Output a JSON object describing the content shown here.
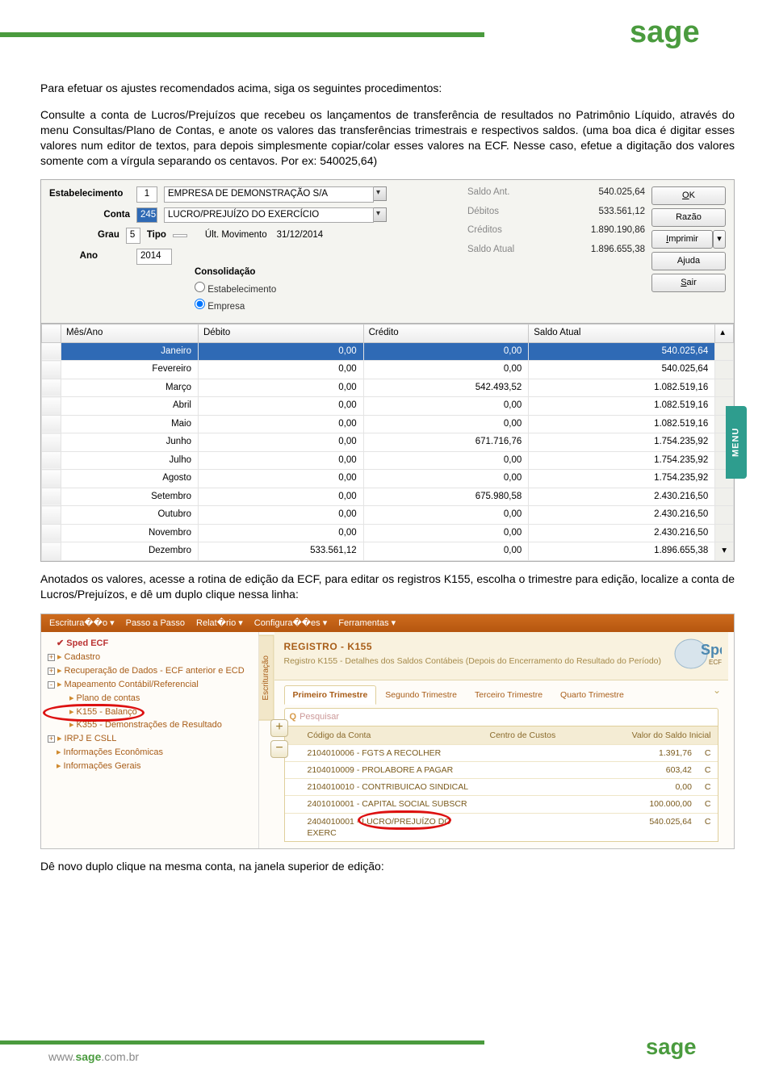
{
  "brand": "sage",
  "header_bar_color": "#4a9b3e",
  "paragraphs": {
    "p1": "Para efetuar os ajustes recomendados acima, siga os seguintes procedimentos:",
    "p2": "Consulte a conta de Lucros/Prejuízos que recebeu os lançamentos de transferência de resultados no Patrimônio Líquido, através do menu Consultas/Plano de Contas, e anote os valores das transferências trimestrais e respectivos saldos. (uma boa dica é digitar esses valores num editor de textos, para depois simplesmente copiar/colar esses valores na ECF. Nesse caso, efetue a digitação dos valores somente com a vírgula separando os centavos. Por ex: 540025,64)",
    "p3": "Anotados os valores, acesse a rotina de edição da ECF, para editar os registros K155, escolha o trimestre para edição, localize a conta de Lucros/Prejuízos, e dê um duplo clique nessa linha:",
    "p4": "Dê novo duplo clique na mesma conta, na janela superior de edição:"
  },
  "shot1": {
    "labels": {
      "estabelecimento": "Estabelecimento",
      "conta": "Conta",
      "grau": "Grau",
      "tipo": "Tipo",
      "ult_mov": "Últ. Movimento",
      "ano": "Ano",
      "consolidacao": "Consolidação",
      "opt_estab": "Estabelecimento",
      "opt_empresa": "Empresa"
    },
    "fields": {
      "estab_num": "1",
      "estab_nome": "EMPRESA DE DEMONSTRAÇÃO S/A",
      "conta_num": "245",
      "conta_nome": "LUCRO/PREJUÍZO DO EXERCÍCIO",
      "grau": "5",
      "tipo": "",
      "ult_mov": "31/12/2014",
      "ano": "2014"
    },
    "summary": {
      "saldo_ant_lbl": "Saldo Ant.",
      "saldo_ant": "540.025,64",
      "debitos_lbl": "Débitos",
      "debitos": "533.561,12",
      "creditos_lbl": "Créditos",
      "creditos": "1.890.190,86",
      "saldo_atual_lbl": "Saldo Atual",
      "saldo_atual": "1.896.655,38"
    },
    "buttons": {
      "ok": "OK",
      "razao": "Razão",
      "imprimir": "Imprimir",
      "ajuda": "Ajuda",
      "sair": "Sair"
    },
    "grid": {
      "headers": [
        "Mês/Ano",
        "Débito",
        "Crédito",
        "Saldo Atual"
      ],
      "rows": [
        {
          "mes": "Janeiro",
          "deb": "0,00",
          "cre": "0,00",
          "sal": "540.025,64",
          "sel": true
        },
        {
          "mes": "Fevereiro",
          "deb": "0,00",
          "cre": "0,00",
          "sal": "540.025,64"
        },
        {
          "mes": "Março",
          "deb": "0,00",
          "cre": "542.493,52",
          "sal": "1.082.519,16"
        },
        {
          "mes": "Abril",
          "deb": "0,00",
          "cre": "0,00",
          "sal": "1.082.519,16"
        },
        {
          "mes": "Maio",
          "deb": "0,00",
          "cre": "0,00",
          "sal": "1.082.519,16"
        },
        {
          "mes": "Junho",
          "deb": "0,00",
          "cre": "671.716,76",
          "sal": "1.754.235,92"
        },
        {
          "mes": "Julho",
          "deb": "0,00",
          "cre": "0,00",
          "sal": "1.754.235,92"
        },
        {
          "mes": "Agosto",
          "deb": "0,00",
          "cre": "0,00",
          "sal": "1.754.235,92"
        },
        {
          "mes": "Setembro",
          "deb": "0,00",
          "cre": "675.980,58",
          "sal": "2.430.216,50"
        },
        {
          "mes": "Outubro",
          "deb": "0,00",
          "cre": "0,00",
          "sal": "2.430.216,50"
        },
        {
          "mes": "Novembro",
          "deb": "0,00",
          "cre": "0,00",
          "sal": "2.430.216,50"
        },
        {
          "mes": "Dezembro",
          "deb": "533.561,12",
          "cre": "0,00",
          "sal": "1.896.655,38"
        }
      ]
    },
    "menu_tab": "MENU"
  },
  "shot2": {
    "menubar": [
      "Escritura��o ▾",
      "Passo a Passo",
      "Relat�rio ▾",
      "Configura��es ▾",
      "Ferramentas ▾"
    ],
    "tree": [
      {
        "t": "Sped ECF",
        "cls": "root",
        "ic": "✔"
      },
      {
        "t": "Cadastro",
        "pm": "+",
        "ic": "doc"
      },
      {
        "t": "Recuperação de Dados - ECF anterior e ECD",
        "pm": "+",
        "ic": "doc"
      },
      {
        "t": "Mapeamento Contábil/Referencial",
        "pm": "-",
        "ic": "doc"
      },
      {
        "t": "Plano de contas",
        "ic": "doc",
        "indent": 1,
        "hl": false
      },
      {
        "t": "K155 - Balanço",
        "ic": "doc",
        "indent": 1,
        "hl": true
      },
      {
        "t": "K355 - Demonstrações de Resultado",
        "ic": "doc",
        "indent": 1,
        "strike": true
      },
      {
        "t": "IRPJ E CSLL",
        "pm": "+",
        "ic": "doc"
      },
      {
        "t": "Informações Econômicas",
        "ic": "doc"
      },
      {
        "t": "Informações Gerais",
        "ic": "doc"
      }
    ],
    "vtab": "Escrituração",
    "reg_title": "REGISTRO - K155",
    "reg_sub": "Registro K155 - Detalhes dos Saldos Contábeis (Depois do Encerramento do Resultado do Período)",
    "spe_badge": "Spe",
    "spe_badge_sub": "ECF",
    "tabs": [
      "Primeiro Trimestre",
      "Segundo Trimestre",
      "Terceiro Trimestre",
      "Quarto Trimestre"
    ],
    "search_placeholder": "Pesquisar",
    "grid_headers": {
      "codigo": "Código da Conta",
      "centro": "Centro de Custos",
      "valor": "Valor do Saldo Inicial"
    },
    "grid_rows": [
      {
        "cod": "2104010006 - FGTS A RECOLHER",
        "val": "1.391,76",
        "nat": "C"
      },
      {
        "cod": "2104010009 - PROLABORE A PAGAR",
        "val": "603,42",
        "nat": "C"
      },
      {
        "cod": "2104010010 - CONTRIBUICAO SINDICAL",
        "val": "0,00",
        "nat": "C"
      },
      {
        "cod": "2401010001 - CAPITAL SOCIAL SUBSCR",
        "val": "100.000,00",
        "nat": "C"
      },
      {
        "cod": "2404010001 - LUCRO/PREJUÍZO DO EXERC",
        "val": "540.025,64",
        "nat": "C",
        "hl": true
      }
    ],
    "plus": "+",
    "minus": "−"
  },
  "footer": {
    "url_pre": "www.",
    "url_b": "sage",
    ".url_post": ".com.br"
  }
}
